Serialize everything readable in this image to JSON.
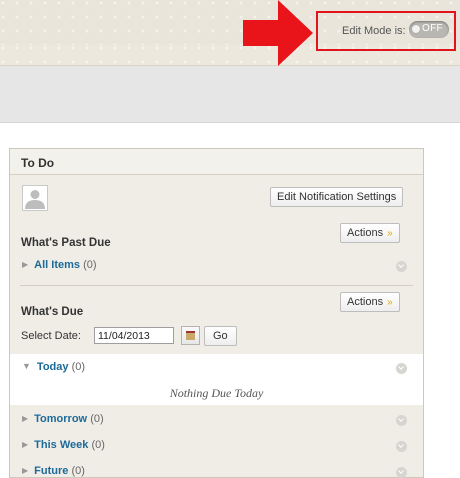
{
  "banner": {
    "edit_mode_label": "Edit Mode is:",
    "edit_mode_state": "OFF"
  },
  "todo": {
    "title": "To Do",
    "edit_notification_button": "Edit Notification Settings",
    "past_due": {
      "title": "What's Past Due",
      "actions_label": "Actions",
      "items": [
        {
          "label": "All Items",
          "count": "(0)"
        }
      ]
    },
    "due": {
      "title": "What's Due",
      "actions_label": "Actions",
      "select_date_label": "Select Date:",
      "select_date_value": "11/04/2013",
      "go_label": "Go",
      "groups": [
        {
          "label": "Today",
          "count": "(0)",
          "expanded": true,
          "empty_text": "Nothing Due Today"
        },
        {
          "label": "Tomorrow",
          "count": "(0)"
        },
        {
          "label": "This Week",
          "count": "(0)"
        },
        {
          "label": "Future",
          "count": "(0)"
        }
      ]
    }
  },
  "colors": {
    "highlight_red": "#e0141a",
    "link_blue": "#1d6a99",
    "actions_chevron": "#e0a800"
  }
}
